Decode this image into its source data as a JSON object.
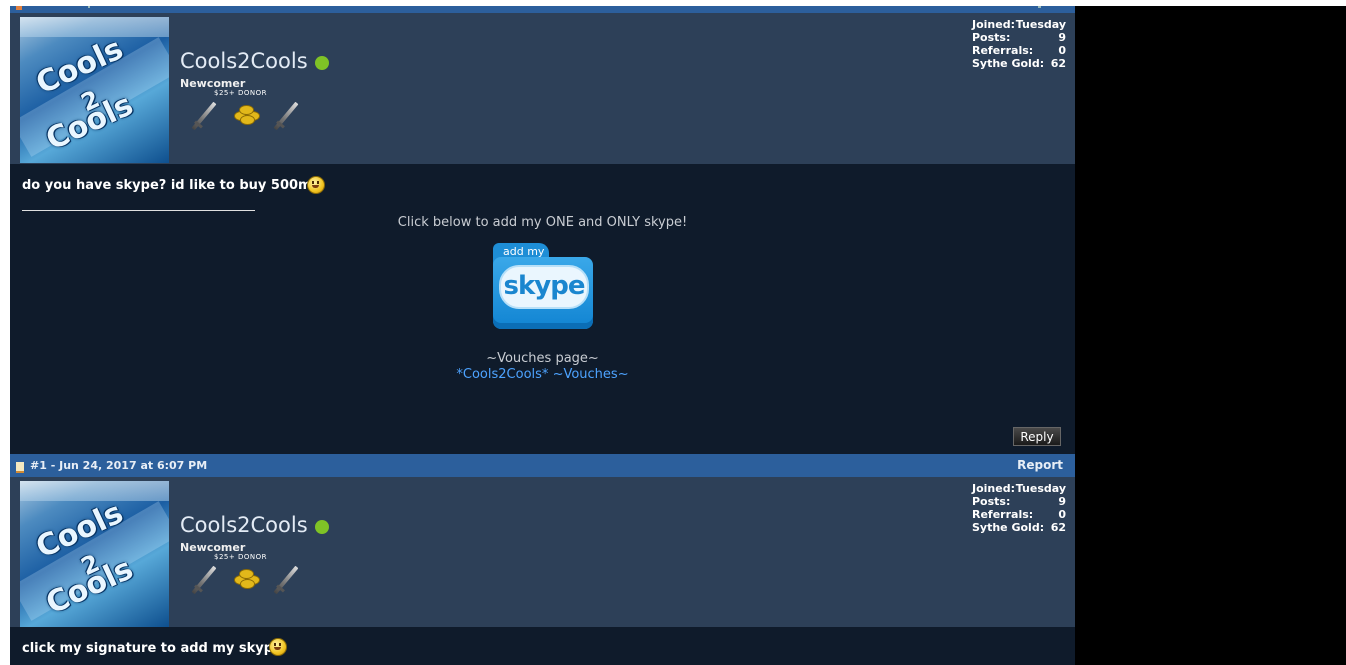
{
  "posts": [
    {
      "username": "Cools2Cools",
      "rank": "Newcomer",
      "badge_label": "$25+ DONOR",
      "avatar_text": [
        "Cools",
        "2",
        "Cools"
      ],
      "stats": {
        "joined_label": "Joined:",
        "joined_value": "Tuesday",
        "posts_label": "Posts:",
        "posts_value": "9",
        "referrals_label": "Referrals:",
        "referrals_value": "0",
        "gold_label": "Sythe Gold:",
        "gold_value": "62"
      },
      "message": "do you have skype? id like to buy 500m+",
      "signature": {
        "title": "Click below to add my ONE and ONLY skype!",
        "skype_tab": "add my",
        "skype_logo": "skype",
        "vouches_title": "~Vouches page~",
        "vouch_link_1": "*Cools2Cools*",
        "vouch_link_2": "~Vouches~"
      },
      "reply_label": "Reply"
    },
    {
      "postbar_info": "#1 - Jun 24, 2017 at 6:07 PM",
      "report_label": "Report",
      "username": "Cools2Cools",
      "rank": "Newcomer",
      "badge_label": "$25+ DONOR",
      "avatar_text": [
        "Cools",
        "2",
        "Cools"
      ],
      "stats": {
        "joined_label": "Joined:",
        "joined_value": "Tuesday",
        "posts_label": "Posts:",
        "posts_value": "9",
        "referrals_label": "Referrals:",
        "referrals_value": "0",
        "gold_label": "Sythe Gold:",
        "gold_value": "62"
      },
      "message": "click my signature to add my skype"
    }
  ]
}
